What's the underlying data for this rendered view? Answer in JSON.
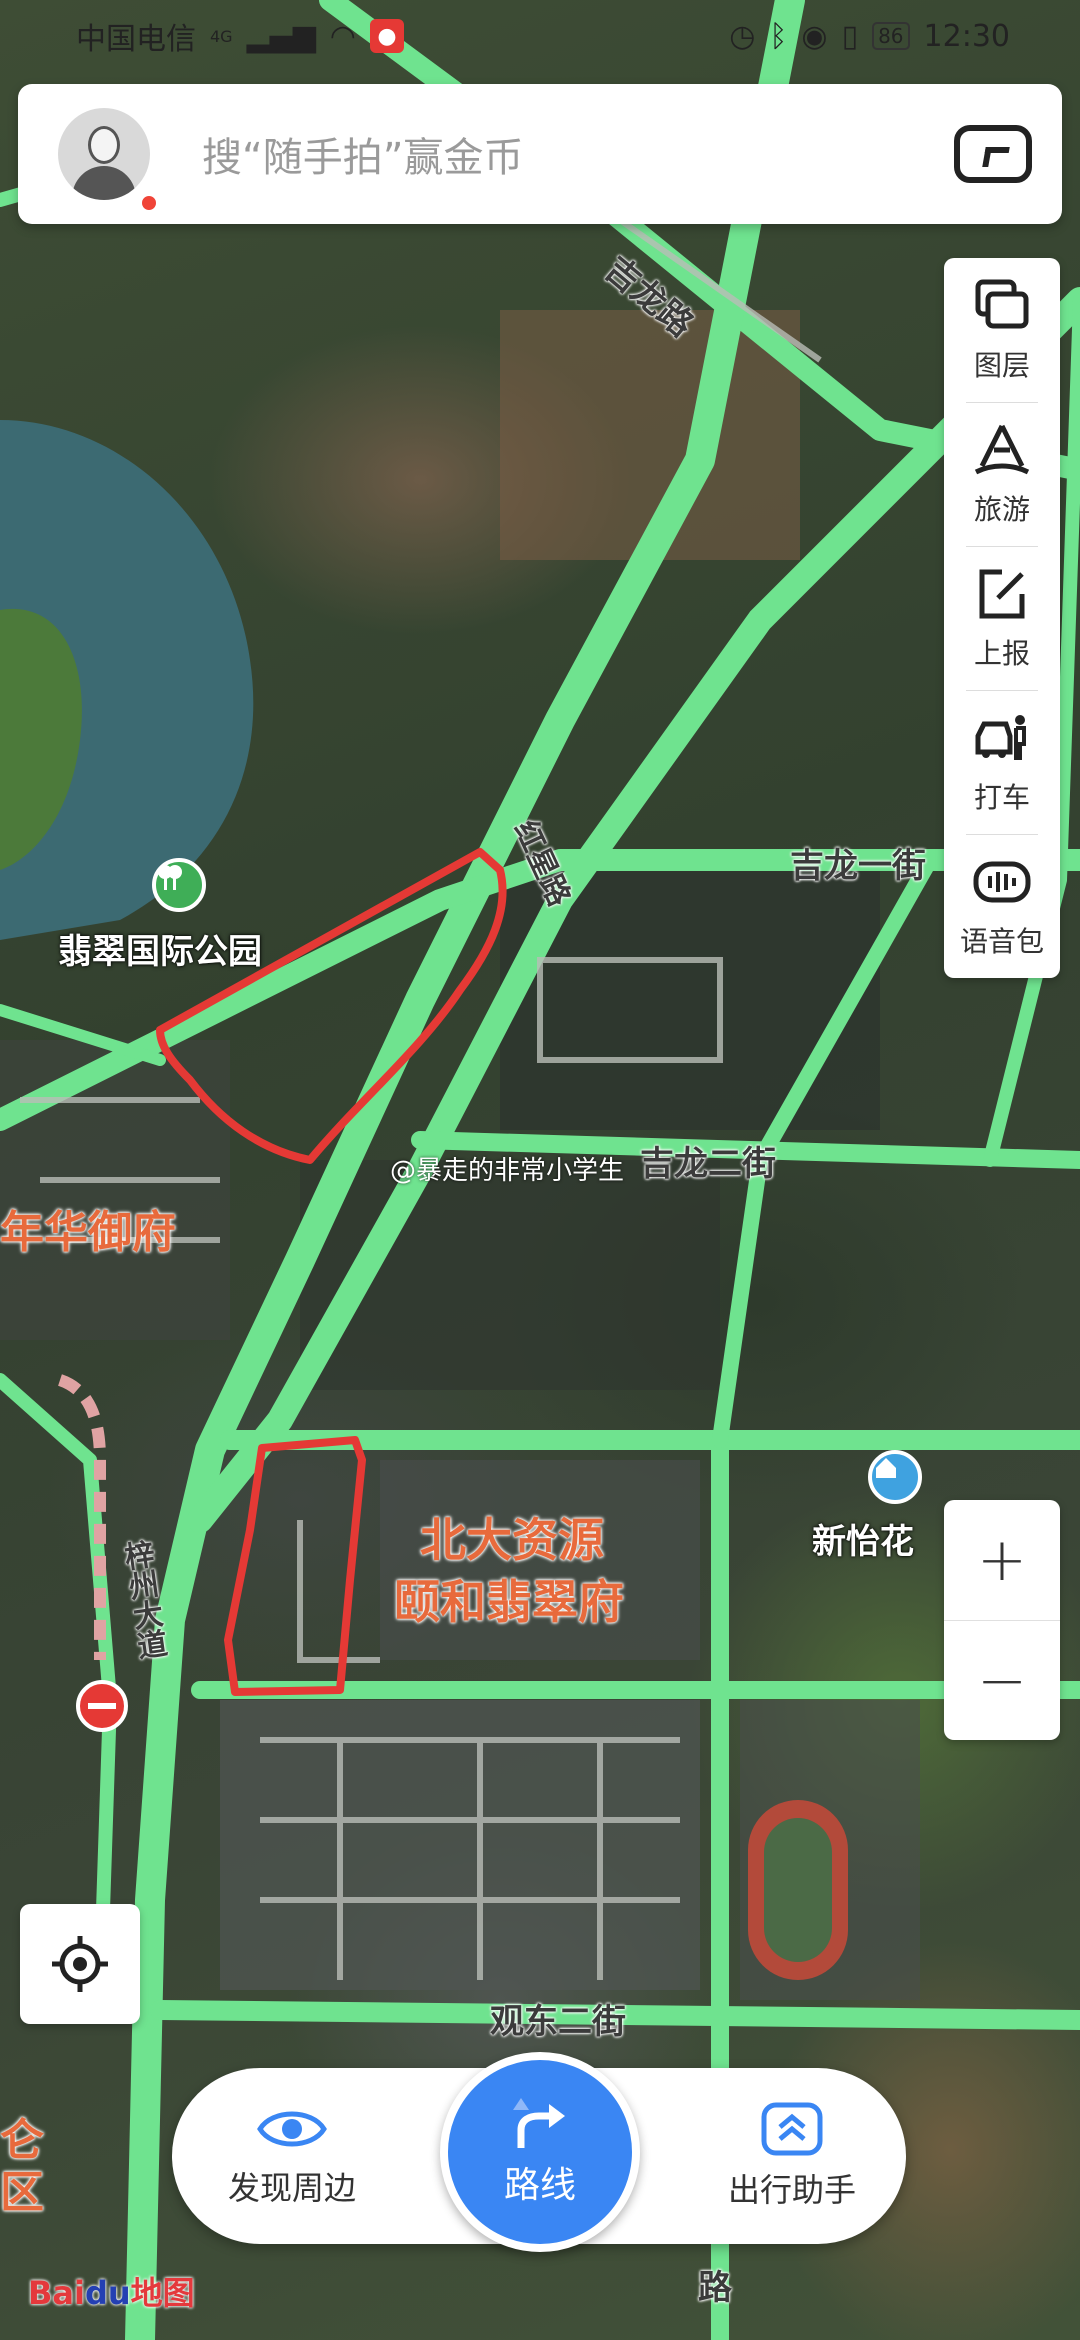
{
  "status_bar": {
    "carrier": "中国电信",
    "network": "4G",
    "battery": "86",
    "time": "12:30"
  },
  "search": {
    "placeholder": "搜“随手拍”赢金币"
  },
  "toolbar": {
    "items": [
      {
        "label": "图层",
        "icon": "layers-icon"
      },
      {
        "label": "旅游",
        "icon": "travel-icon"
      },
      {
        "label": "上报",
        "icon": "report-icon"
      },
      {
        "label": "打车",
        "icon": "taxi-icon"
      },
      {
        "label": "语音包",
        "icon": "voice-pack-icon"
      }
    ]
  },
  "zoom": {
    "in": "+",
    "out": "−"
  },
  "map": {
    "road_labels": {
      "jilong_road": "吉龙路",
      "hongguang_road": "红星路",
      "jilong_1st": "吉龙一街",
      "jilong_2nd": "吉龙二街",
      "zizhou_ave": "梓州大道",
      "guandong_2nd": "观东二街",
      "road_bottom": "路"
    },
    "places": {
      "park": "翡翠国际公园",
      "estate_left": "年华御府",
      "estate_main_line1": "北大资源",
      "estate_main_line2": "颐和翡翠府",
      "xinyi": "新怡花",
      "left_edge_1": "仑",
      "left_edge_2": "区"
    },
    "watermark": "@暴走的非常小学生"
  },
  "bottom_bar": {
    "discover": "发现周边",
    "route": "路线",
    "assistant": "出行助手"
  },
  "brand": {
    "bai": "Bai",
    "du": "du",
    "suffix": "地图"
  },
  "colors": {
    "accent": "#3a86f3",
    "road": "#6fe38f",
    "annotation": "#e53935"
  }
}
